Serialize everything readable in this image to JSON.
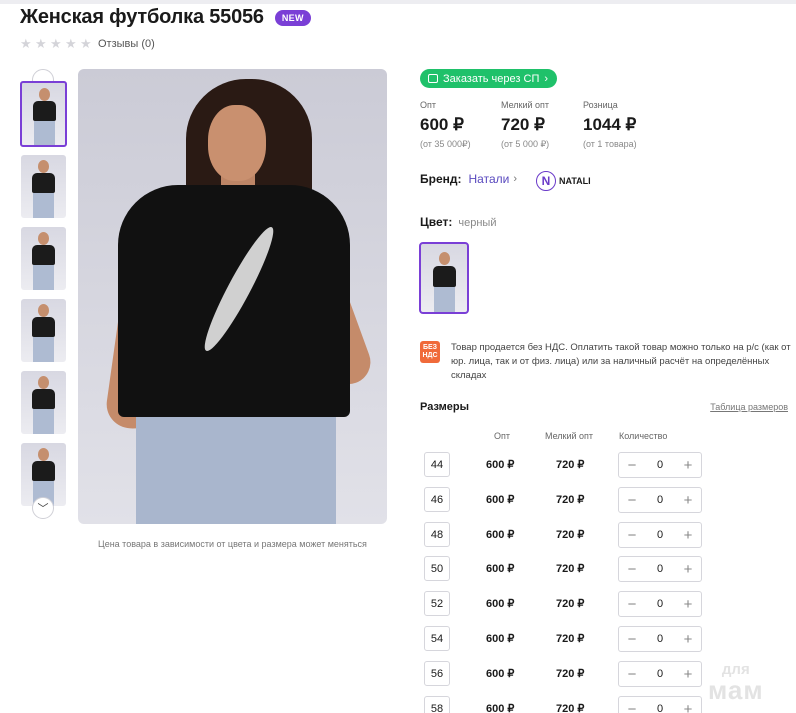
{
  "product": {
    "title": "Женская футболка 55056",
    "badge": "NEW",
    "reviews_label": "Отзывы (0)",
    "rating": 0,
    "image_note": "Цена товара в зависимости от цвета и размера может меняться"
  },
  "order_button": {
    "label": "Заказать через СП",
    "icon": "cart-icon"
  },
  "prices": [
    {
      "label": "Опт",
      "value": "600 ₽",
      "sub": "(от 35 000₽)"
    },
    {
      "label": "Мелкий опт",
      "value": "720 ₽",
      "sub": "(от 5 000 ₽)"
    },
    {
      "label": "Розница",
      "value": "1044 ₽",
      "sub": "(от 1 товара)"
    }
  ],
  "brand": {
    "label": "Бренд:",
    "value": "Натали",
    "logo_letter": "N",
    "logo_text": "NATALI"
  },
  "color": {
    "label": "Цвет:",
    "value": "черный"
  },
  "vat": {
    "icon_text_1": "БЕЗ",
    "icon_text_2": "НДС",
    "text": "Товар продается без НДС. Оплатить такой товар можно только на р/с (как от юр. лица, так и от физ. лица) или за наличный расчёт на определённых складах"
  },
  "sizes": {
    "title": "Размеры",
    "table_link": "Таблица размеров",
    "columns": [
      "Опт",
      "Мелкий опт",
      "Количество"
    ],
    "rows": [
      {
        "size": "44",
        "opt": "600 ₽",
        "small_opt": "720 ₽",
        "qty": "0"
      },
      {
        "size": "46",
        "opt": "600 ₽",
        "small_opt": "720 ₽",
        "qty": "0"
      },
      {
        "size": "48",
        "opt": "600 ₽",
        "small_opt": "720 ₽",
        "qty": "0"
      },
      {
        "size": "50",
        "opt": "600 ₽",
        "small_opt": "720 ₽",
        "qty": "0"
      },
      {
        "size": "52",
        "opt": "600 ₽",
        "small_opt": "720 ₽",
        "qty": "0"
      },
      {
        "size": "54",
        "opt": "600 ₽",
        "small_opt": "720 ₽",
        "qty": "0"
      },
      {
        "size": "56",
        "opt": "600 ₽",
        "small_opt": "720 ₽",
        "qty": "0"
      },
      {
        "size": "58",
        "opt": "600 ₽",
        "small_opt": "720 ₽",
        "qty": "0"
      }
    ]
  },
  "watermark": {
    "line1": "для",
    "line2": "мам"
  },
  "colors": {
    "accent": "#7a3fd6",
    "order_green": "#1fc16a",
    "vat_orange": "#f06a3a"
  }
}
